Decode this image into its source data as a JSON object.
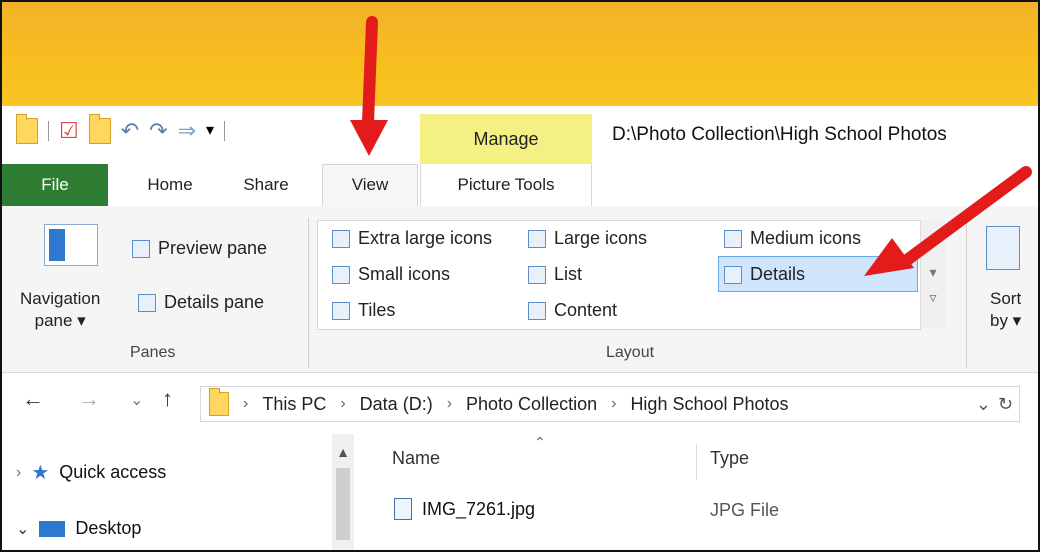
{
  "window": {
    "title_path": "D:\\Photo Collection\\High School Photos",
    "contextual_tab_group": "Manage"
  },
  "tabs": [
    {
      "label": "File"
    },
    {
      "label": "Home"
    },
    {
      "label": "Share"
    },
    {
      "label": "View"
    },
    {
      "label": "Picture Tools"
    }
  ],
  "ribbon": {
    "panes": {
      "label": "Panes",
      "navigation_pane": "Navigation",
      "navigation_pane_line2": "pane ▾",
      "preview_pane": "Preview pane",
      "details_pane": "Details pane"
    },
    "layout": {
      "label": "Layout",
      "items": {
        "extra_large": "Extra large icons",
        "large": "Large icons",
        "medium": "Medium icons",
        "small": "Small icons",
        "list": "List",
        "details": "Details",
        "tiles": "Tiles",
        "content": "Content"
      }
    },
    "sort": {
      "label_line1": "Sort",
      "label_line2": "by ▾"
    }
  },
  "address": {
    "breadcrumbs": [
      "This PC",
      "Data (D:)",
      "Photo Collection",
      "High School Photos"
    ]
  },
  "navigation": {
    "items": [
      {
        "label": "Quick access"
      },
      {
        "label": "Desktop"
      }
    ]
  },
  "file_list": {
    "columns": [
      "Name",
      "Type"
    ],
    "rows": [
      {
        "name": "IMG_7261.jpg",
        "type": "JPG File"
      }
    ]
  },
  "colors": {
    "file_tab": "#2f7d32",
    "manage_tab": "#f5f083",
    "top_band": "#f7bf1e",
    "selection": "#cfe5fb",
    "arrow": "#e31b1b"
  }
}
